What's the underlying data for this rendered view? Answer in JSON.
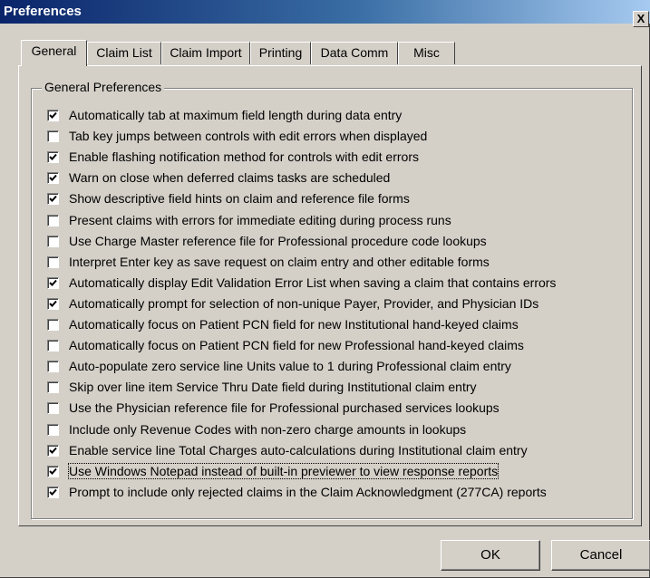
{
  "window": {
    "title": "Preferences",
    "close_glyph": "X"
  },
  "tabs": [
    {
      "label": "General",
      "active": true
    },
    {
      "label": "Claim List"
    },
    {
      "label": "Claim Import"
    },
    {
      "label": "Printing"
    },
    {
      "label": "Data Comm"
    },
    {
      "label": "Misc"
    }
  ],
  "group": {
    "title": "General Preferences"
  },
  "options": [
    {
      "label": "Automatically tab at maximum field length during data entry",
      "checked": true
    },
    {
      "label": "Tab key jumps between controls with edit errors when displayed",
      "checked": false
    },
    {
      "label": "Enable flashing notification method for controls with edit errors",
      "checked": true
    },
    {
      "label": "Warn on close when deferred claims tasks are scheduled",
      "checked": true
    },
    {
      "label": "Show descriptive field hints on claim and reference file forms",
      "checked": true
    },
    {
      "label": "Present claims with errors for immediate editing during process runs",
      "checked": false
    },
    {
      "label": "Use Charge Master reference file for Professional procedure code lookups",
      "checked": false
    },
    {
      "label": "Interpret Enter key as save request on claim entry and other editable forms",
      "checked": false
    },
    {
      "label": "Automatically display Edit Validation Error List when saving a claim that contains errors",
      "checked": true
    },
    {
      "label": "Automatically prompt for selection of non-unique Payer, Provider, and Physician IDs",
      "checked": true
    },
    {
      "label": "Automatically focus on Patient PCN field for new Institutional hand-keyed claims",
      "checked": false
    },
    {
      "label": "Automatically focus on Patient PCN field for new Professional hand-keyed claims",
      "checked": false
    },
    {
      "label": "Auto-populate zero service line Units value to 1 during Professional claim entry",
      "checked": false
    },
    {
      "label": "Skip over line item Service Thru Date field during Institutional claim entry",
      "checked": false
    },
    {
      "label": "Use the Physician reference file for Professional purchased services lookups",
      "checked": false
    },
    {
      "label": "Include only Revenue Codes with non-zero charge amounts in lookups",
      "checked": false
    },
    {
      "label": "Enable service line Total Charges auto-calculations during Institutional claim entry",
      "checked": true
    },
    {
      "label": "Use Windows Notepad instead of built-in previewer to view response reports",
      "checked": true,
      "focused": true
    },
    {
      "label": "Prompt to include only rejected claims in the Claim Acknowledgment (277CA) reports",
      "checked": true
    }
  ],
  "buttons": {
    "ok": "OK",
    "cancel": "Cancel"
  }
}
